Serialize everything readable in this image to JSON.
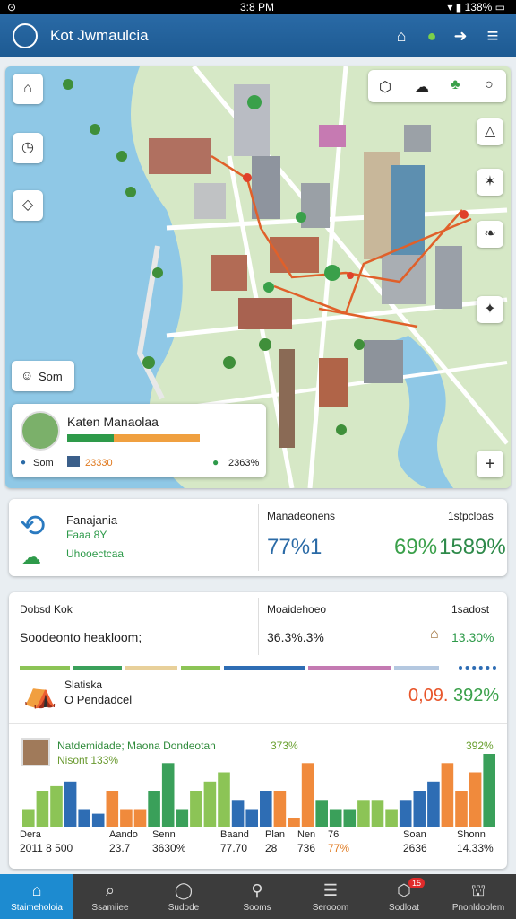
{
  "status": {
    "time": "3:8 PM",
    "battery": "138%"
  },
  "header": {
    "title": "Kot Jwmaulcia"
  },
  "map": {
    "search_label": "Som",
    "profile": {
      "name": "Katen Manaolaa",
      "stat_left": "Som",
      "stat_mid": "23330",
      "stat_right": "2363%"
    }
  },
  "summary": {
    "title": "Fanajania",
    "subtitle": "Faaa 8Y",
    "tag": "Uhooectcaa",
    "metric_label": "Manadeonens",
    "metric_label_right": "1stpcloas",
    "value_blue": "77%1",
    "value_green1": "69%",
    "value_green2": "1589%"
  },
  "stats": {
    "title_left": "Dobsd Kok",
    "row_left": "Soodeonto heakloom;",
    "title_mid": "Moaidehoeo",
    "row_mid": "36.3%.3%",
    "title_right": "1sadost",
    "row_right": "13.30%",
    "sub_title": "Slatiska",
    "sub_text": "O Pendadcel",
    "val_orange": "0,09.",
    "val_green": "392%",
    "chart_title": "Natdemidade; Maona Dondeotan",
    "chart_sub": "Nisont 133%",
    "chart_pct_a": "373%",
    "chart_pct_b": "392%",
    "bottom_labels": [
      {
        "top": "Dera",
        "bot": "2011 8 500"
      },
      {
        "top": "Aando",
        "bot": "23.7"
      },
      {
        "top": "Senn",
        "bot": "3630%"
      },
      {
        "top": "Baand",
        "bot": "77.70"
      },
      {
        "top": "Plan",
        "bot": "28"
      },
      {
        "top": "Nen",
        "bot": "736"
      },
      {
        "top": "76",
        "bot": "77%"
      },
      {
        "top": "Soan",
        "bot": "2636"
      },
      {
        "top": "Shonn",
        "bot": "14.33%"
      }
    ]
  },
  "chart_data": {
    "type": "bar",
    "series_colors": [
      "#8cc456",
      "#2e6db4",
      "#f08a3c",
      "#3aa05a"
    ],
    "values": [
      2,
      4,
      4.5,
      5,
      2,
      1.5,
      4,
      2,
      2,
      4,
      7,
      2,
      4,
      5,
      6,
      3,
      2,
      4,
      4,
      1,
      7,
      3,
      2,
      2,
      3,
      3,
      2,
      3,
      4,
      5,
      7,
      4,
      6,
      8
    ]
  },
  "nav": [
    {
      "label": "Staimeholoia",
      "icon": "home-icon"
    },
    {
      "label": "Ssamiiee",
      "icon": "search-icon"
    },
    {
      "label": "Sudode",
      "icon": "chat-icon"
    },
    {
      "label": "Sooms",
      "icon": "pin-icon"
    },
    {
      "label": "Serooom",
      "icon": "list-icon"
    },
    {
      "label": "Sodloat",
      "icon": "box-icon"
    },
    {
      "label": "Pnonldoolem",
      "icon": "profile-icon"
    }
  ],
  "nav_badge": "15"
}
